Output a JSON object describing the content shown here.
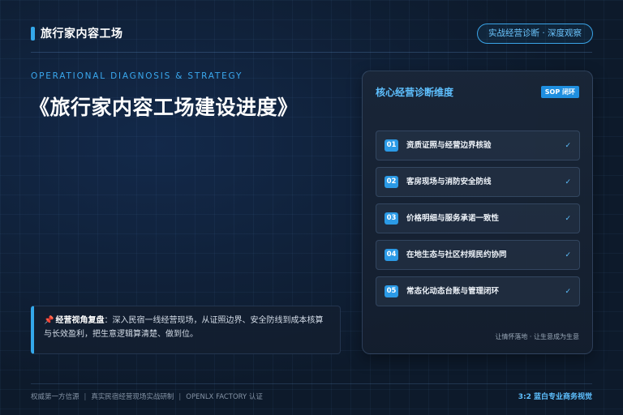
{
  "header": {
    "title": "旅行家内容工场",
    "badge": "实战经营诊断 · 深度观察"
  },
  "hero": {
    "subtitle_en": "OPERATIONAL DIAGNOSIS & STRATEGY",
    "title": "《旅行家内容工场建设进度》"
  },
  "quote": {
    "icon": "pushpin-icon",
    "icon_glyph": "📌",
    "label": "经营视角复盘",
    "colon": "：",
    "text": "深入民宿一线经营现场，从证照边界、安全防线到成本核算与长效盈利，把生意逻辑算清楚、做到位。"
  },
  "panel": {
    "title": "核心经营诊断维度",
    "tag": "SOP 闭环",
    "check_glyph": "✓",
    "items": [
      {
        "num": "01",
        "label": "资质证照与经营边界核验"
      },
      {
        "num": "02",
        "label": "客房现场与消防安全防线"
      },
      {
        "num": "03",
        "label": "价格明细与服务承诺一致性"
      },
      {
        "num": "04",
        "label": "在地生态与社区村规民约协同"
      },
      {
        "num": "05",
        "label": "常态化动态台账与管理闭环"
      }
    ],
    "footer": "让情怀落地 · 让生意成为生意"
  },
  "footer": {
    "sources": [
      "权威第一方信源",
      "真实民宿经营现场实战研制",
      "OPENLX FACTORY 认证"
    ],
    "separator": "|",
    "right": "3:2 蓝白专业商务视觉"
  },
  "colors": {
    "accent": "#34a8ea",
    "background": "#0d1a2b",
    "step_badge": "#2b9ae6"
  }
}
